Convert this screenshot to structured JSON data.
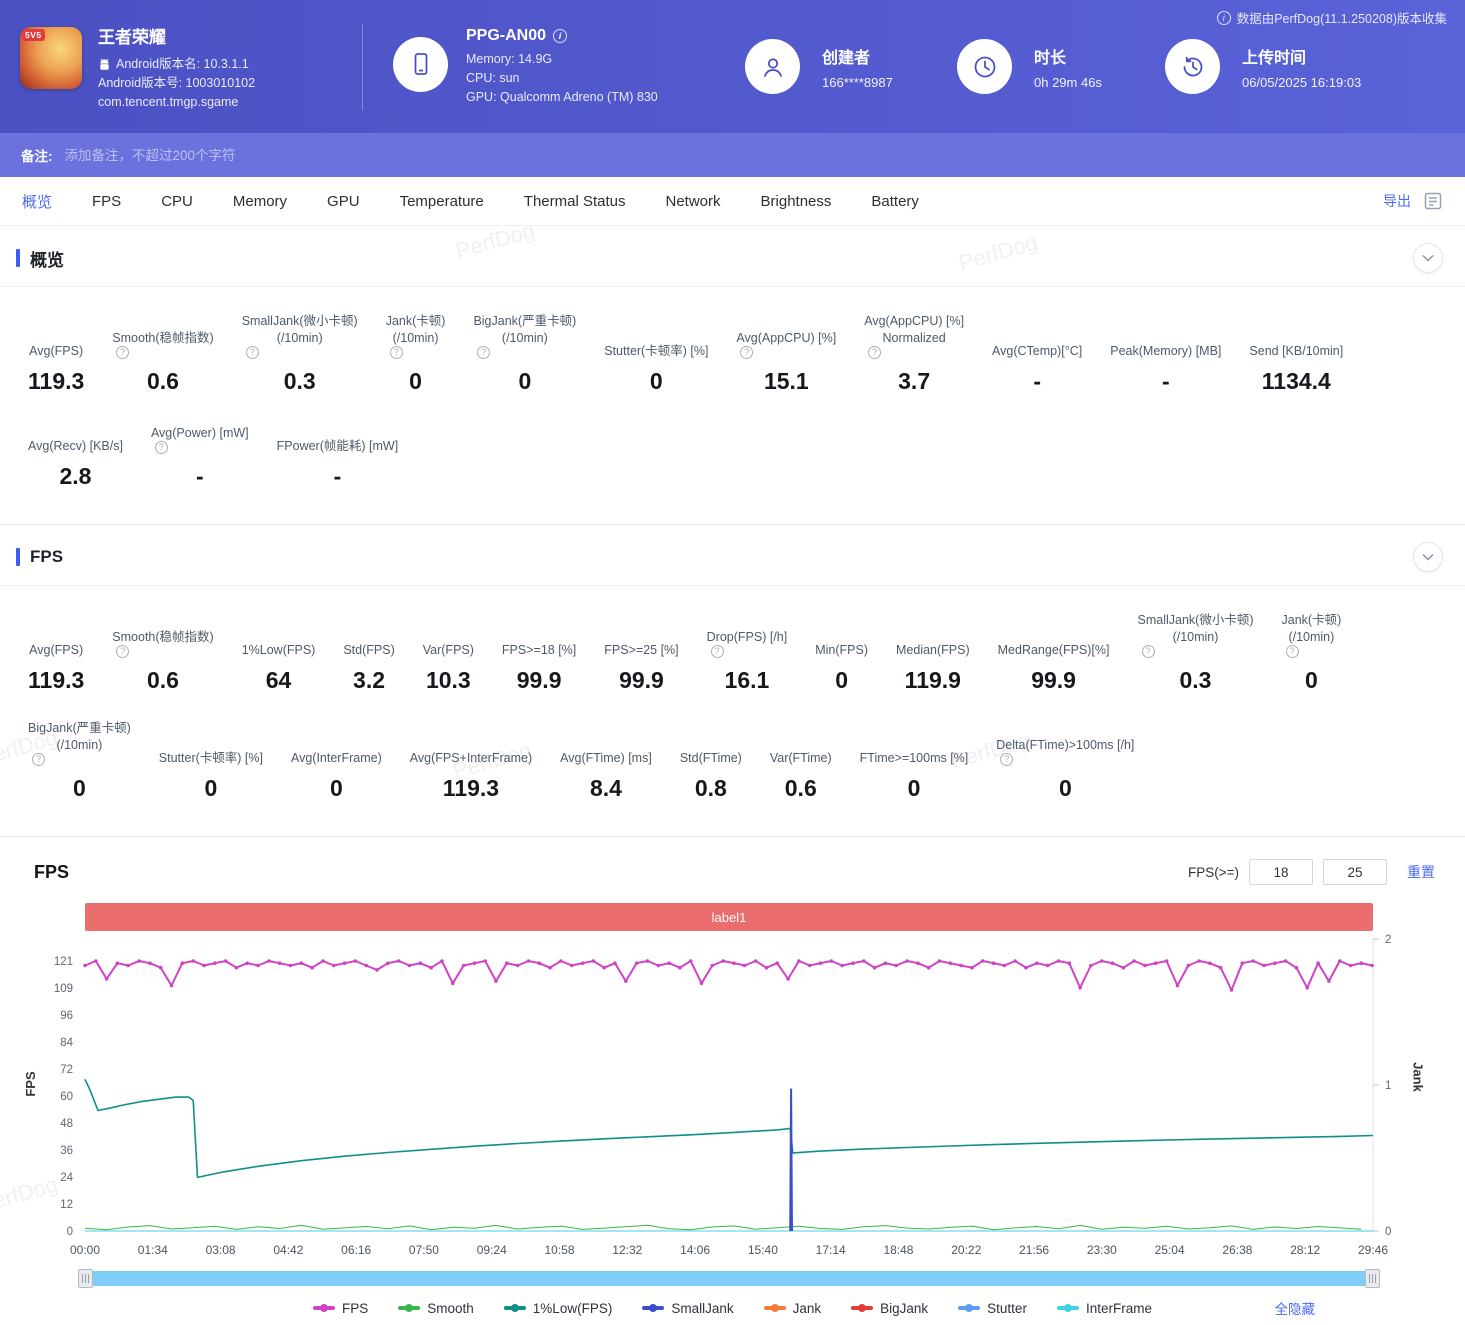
{
  "colors": {
    "accent": "#4a6af5",
    "banner": "#eb6d6d",
    "header_left": "#4b51c3",
    "header_right": "#5a62d8",
    "note_bar": "#6b72de",
    "scrollbar": "#7ecef7"
  },
  "watermark": "PerfDog",
  "header": {
    "collect_note": "数据由PerfDog(11.1.250208)版本收集",
    "app": {
      "title": "王者荣耀",
      "badge": "5V5",
      "version_name": "Android版本名: 10.3.1.1",
      "version_code": "Android版本号: 1003010102",
      "package": "com.tencent.tmgp.sgame"
    },
    "device": {
      "name": "PPG-AN00",
      "memory": "Memory: 14.9G",
      "cpu": "CPU: sun",
      "gpu": "GPU: Qualcomm Adreno (TM) 830"
    },
    "creator": {
      "label": "创建者",
      "value": "166****8987"
    },
    "duration": {
      "label": "时长",
      "value": "0h 29m 46s"
    },
    "upload": {
      "label": "上传时间",
      "value": "06/05/2025 16:19:03"
    }
  },
  "note_bar": {
    "label": "备注:",
    "placeholder": "添加备注，不超过200个字符"
  },
  "tabs": {
    "active": "概览",
    "export_label": "导出",
    "items": [
      {
        "label": "概览",
        "slug": "overview"
      },
      {
        "label": "FPS",
        "slug": "fps"
      },
      {
        "label": "CPU",
        "slug": "cpu"
      },
      {
        "label": "Memory",
        "slug": "memory"
      },
      {
        "label": "GPU",
        "slug": "gpu"
      },
      {
        "label": "Temperature",
        "slug": "temperature"
      },
      {
        "label": "Thermal Status",
        "slug": "thermal-status"
      },
      {
        "label": "Network",
        "slug": "network"
      },
      {
        "label": "Brightness",
        "slug": "brightness"
      },
      {
        "label": "Battery",
        "slug": "battery"
      }
    ]
  },
  "overview": {
    "title": "概览",
    "rows": [
      [
        {
          "l1": "Avg(FPS)",
          "value": "119.3"
        },
        {
          "l1": "Smooth(稳帧指数)",
          "help": true,
          "value": "0.6"
        },
        {
          "l1": "SmallJank(微小卡顿)",
          "l2": "(/10min)",
          "help": true,
          "value": "0.3"
        },
        {
          "l1": "Jank(卡顿)",
          "l2": "(/10min)",
          "help": true,
          "value": "0"
        },
        {
          "l1": "BigJank(严重卡顿)",
          "l2": "(/10min)",
          "help": true,
          "value": "0"
        },
        {
          "l1": "Stutter(卡顿率) [%]",
          "value": "0"
        },
        {
          "l1": "Avg(AppCPU) [%]",
          "help": true,
          "value": "15.1"
        },
        {
          "l1": "Avg(AppCPU) [%]",
          "l2": "Normalized",
          "help": true,
          "value": "3.7"
        },
        {
          "l1": "Avg(CTemp)[°C]",
          "value": "-"
        },
        {
          "l1": "Peak(Memory) [MB]",
          "value": "-"
        },
        {
          "l1": "Send [KB/10min]",
          "value": "1134.4"
        }
      ],
      [
        {
          "l1": "Avg(Recv) [KB/s]",
          "value": "2.8"
        },
        {
          "l1": "Avg(Power) [mW]",
          "help": true,
          "value": "-"
        },
        {
          "l1": "FPower(帧能耗) [mW]",
          "value": "-"
        }
      ]
    ]
  },
  "fps_summary": {
    "title": "FPS",
    "rows": [
      [
        {
          "l1": "Avg(FPS)",
          "value": "119.3"
        },
        {
          "l1": "Smooth(稳帧指数)",
          "help": true,
          "value": "0.6"
        },
        {
          "l1": "1%Low(FPS)",
          "value": "64"
        },
        {
          "l1": "Std(FPS)",
          "value": "3.2"
        },
        {
          "l1": "Var(FPS)",
          "value": "10.3"
        },
        {
          "l1": "FPS>=18 [%]",
          "value": "99.9"
        },
        {
          "l1": "FPS>=25 [%]",
          "value": "99.9"
        },
        {
          "l1": "Drop(FPS) [/h]",
          "help": true,
          "value": "16.1"
        },
        {
          "l1": "Min(FPS)",
          "value": "0"
        },
        {
          "l1": "Median(FPS)",
          "value": "119.9"
        },
        {
          "l1": "MedRange(FPS)[%]",
          "value": "99.9"
        },
        {
          "l1": "SmallJank(微小卡顿)",
          "l2": "(/10min)",
          "help": true,
          "value": "0.3"
        },
        {
          "l1": "Jank(卡顿)",
          "l2": "(/10min)",
          "help": true,
          "value": "0"
        }
      ],
      [
        {
          "l1": "BigJank(严重卡顿)",
          "l2": "(/10min)",
          "help": true,
          "value": "0"
        },
        {
          "l1": "Stutter(卡顿率) [%]",
          "value": "0"
        },
        {
          "l1": "Avg(InterFrame)",
          "value": "0"
        },
        {
          "l1": "Avg(FPS+InterFrame)",
          "value": "119.3"
        },
        {
          "l1": "Avg(FTime) [ms]",
          "value": "8.4"
        },
        {
          "l1": "Std(FTime)",
          "value": "0.8"
        },
        {
          "l1": "Var(FTime)",
          "value": "0.6"
        },
        {
          "l1": "FTime>=100ms [%]",
          "value": "0"
        },
        {
          "l1": "Delta(FTime)>100ms [/h]",
          "help": true,
          "value": "0"
        }
      ]
    ]
  },
  "fps_chart": {
    "title": "FPS",
    "threshold_label": "FPS(>=)",
    "threshold_low": "18",
    "threshold_high": "25",
    "reset_label": "重置",
    "hide_all_label": "全隐藏",
    "banner": "label1",
    "chart_data": {
      "type": "line",
      "title": "FPS",
      "annotation": "label1",
      "x_axis": {
        "total_minutes": 29.77,
        "ticks": [
          "00:00",
          "01:34",
          "03:08",
          "04:42",
          "06:16",
          "07:50",
          "09:24",
          "10:58",
          "12:32",
          "14:06",
          "15:40",
          "17:14",
          "18:48",
          "20:22",
          "21:56",
          "23:30",
          "25:04",
          "26:38",
          "28:12",
          "29:46"
        ]
      },
      "y_left": {
        "name": "FPS",
        "max": 121,
        "ticks": [
          0,
          12,
          24,
          36,
          48,
          60,
          72,
          84,
          96,
          109,
          121
        ]
      },
      "y_right": {
        "name": "Jank",
        "max": 2,
        "ticks": [
          0,
          1,
          2
        ]
      },
      "series": [
        {
          "name": "FPS",
          "color": "#cf43c5",
          "axis": "left",
          "z": 5,
          "width": 2,
          "dots": true,
          "x_step": 0.25,
          "values": [
            119,
            121,
            113,
            120,
            119,
            121,
            120,
            118,
            110,
            120,
            121,
            119,
            120,
            121,
            118,
            120,
            119,
            121,
            120,
            119,
            120,
            118,
            121,
            119,
            120,
            121,
            119,
            117,
            120,
            121,
            119,
            120,
            118,
            121,
            111,
            119,
            120,
            121,
            112,
            120,
            119,
            121,
            120,
            118,
            121,
            119,
            120,
            121,
            118,
            120,
            112,
            120,
            121,
            119,
            120,
            118,
            121,
            111,
            119,
            121,
            120,
            119,
            121,
            118,
            120,
            113,
            121,
            119,
            120,
            121,
            119,
            120,
            121,
            118,
            120,
            119,
            121,
            120,
            118,
            121,
            120,
            119,
            118,
            121,
            120,
            119,
            121,
            118,
            120,
            119,
            121,
            120,
            109,
            119,
            121,
            120,
            118,
            121,
            119,
            120,
            121,
            110,
            119,
            121,
            120,
            118,
            108,
            120,
            121,
            119,
            120,
            121,
            118,
            109,
            120,
            112,
            121,
            119,
            120,
            119
          ]
        },
        {
          "name": "Smooth",
          "color": "#3cb44a",
          "axis": "left",
          "z": 2,
          "width": 1,
          "x_step": 0.5,
          "values": [
            1.2,
            0.6,
            1.8,
            2.4,
            0.9,
            1.5,
            2.1,
            0.7,
            1.9,
            1.1,
            2.6,
            0.8,
            1.4,
            2.0,
            1.0,
            2.3,
            0.6,
            1.7,
            1.2,
            2.5,
            0.9,
            1.6,
            2.2,
            0.7,
            1.3,
            1.9,
            2.6,
            1.0,
            0.6,
            1.8,
            2.3,
            0.8,
            1.5,
            2.1,
            1.1,
            0.7,
            1.9,
            2.4,
            1.3,
            0.9,
            1.6,
            2.2,
            0.6,
            1.4,
            2.0,
            1.0,
            2.5,
            0.8,
            1.7,
            1.2,
            2.1,
            0.9,
            1.5,
            2.3,
            0.7,
            1.8,
            1.1,
            2.0,
            1.4,
            0.8
          ]
        },
        {
          "name": "1%Low(FPS)",
          "color": "#0e8f88",
          "axis": "left",
          "z": 3,
          "width": 1.6,
          "points": [
            [
              0,
              68
            ],
            [
              0.12,
              63
            ],
            [
              0.3,
              54
            ],
            [
              0.55,
              55
            ],
            [
              0.9,
              56.5
            ],
            [
              1.3,
              58
            ],
            [
              1.7,
              59
            ],
            [
              2.1,
              60
            ],
            [
              2.4,
              60
            ],
            [
              2.5,
              58.5
            ],
            [
              2.6,
              24
            ],
            [
              3.2,
              26.5
            ],
            [
              4,
              29
            ],
            [
              5,
              31.5
            ],
            [
              6,
              33.5
            ],
            [
              7,
              35.2
            ],
            [
              8,
              36.6
            ],
            [
              9,
              38
            ],
            [
              10,
              39.2
            ],
            [
              11,
              40.3
            ],
            [
              12,
              41.3
            ],
            [
              13,
              42.2
            ],
            [
              14,
              43.1
            ],
            [
              15,
              44.2
            ],
            [
              16,
              45.3
            ],
            [
              16.3,
              46
            ],
            [
              16.36,
              35
            ],
            [
              17,
              35.8
            ],
            [
              18,
              36.7
            ],
            [
              19,
              37.4
            ],
            [
              20,
              38.1
            ],
            [
              21,
              38.7
            ],
            [
              22,
              39.3
            ],
            [
              23,
              39.8
            ],
            [
              24,
              40.3
            ],
            [
              25,
              40.8
            ],
            [
              26,
              41.2
            ],
            [
              27,
              41.6
            ],
            [
              28,
              42
            ],
            [
              29,
              42.4
            ],
            [
              29.77,
              42.8
            ]
          ]
        },
        {
          "name": "SmallJank",
          "color": "#3c4ec8",
          "axis": "right",
          "z": 4,
          "width": 2,
          "points": [
            [
              16.3,
              0
            ],
            [
              16.32,
              0.97
            ],
            [
              16.34,
              0
            ]
          ]
        },
        {
          "name": "Jank",
          "color": "#f77b34",
          "axis": "right",
          "z": 1,
          "width": 1,
          "points": [
            [
              0,
              0
            ],
            [
              29.77,
              0
            ]
          ]
        },
        {
          "name": "BigJank",
          "color": "#e13c39",
          "axis": "right",
          "z": 1,
          "width": 1,
          "points": []
        },
        {
          "name": "Stutter",
          "color": "#5c9df2",
          "axis": "right",
          "z": 1,
          "width": 1,
          "points": [
            [
              0,
              0
            ],
            [
              29.77,
              0
            ]
          ]
        },
        {
          "name": "InterFrame",
          "color": "#3fd2e0",
          "axis": "left",
          "z": 1,
          "width": 1,
          "points": [
            [
              0,
              0
            ],
            [
              29.77,
              0
            ]
          ]
        }
      ]
    }
  }
}
